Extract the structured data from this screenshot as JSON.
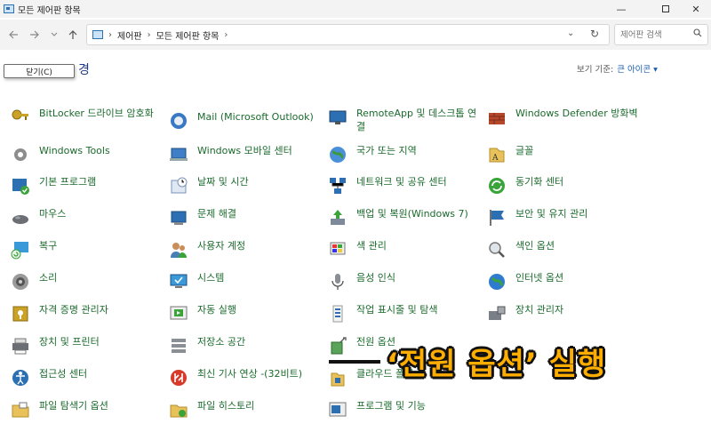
{
  "window": {
    "title": "모든 제어판 항목",
    "minimize": "—",
    "close": "✕"
  },
  "address": {
    "crumbs": [
      "제어판",
      "모든 제어판 항목"
    ],
    "search_placeholder": "제어판 검색"
  },
  "heading": "경",
  "view": {
    "label": "보기 기준:",
    "value": "큰 아이콘 ▾"
  },
  "tooltip": {
    "close_label": "닫기(C)"
  },
  "items": [
    {
      "label": "BitLocker 드라이브 암호화",
      "icon": "bitlocker-icon"
    },
    {
      "label": "Mail (Microsoft Outlook)",
      "icon": "mail-icon"
    },
    {
      "label": "RemoteApp 및 데스크톱 연결",
      "icon": "remoteapp-icon"
    },
    {
      "label": "Windows Defender 방화벽",
      "icon": "firewall-icon"
    },
    {
      "label": "Windows Tools",
      "icon": "windows-tools-icon"
    },
    {
      "label": "Windows 모바일 센터",
      "icon": "mobility-center-icon"
    },
    {
      "label": "국가 또는 지역",
      "icon": "region-icon"
    },
    {
      "label": "글꼴",
      "icon": "fonts-icon"
    },
    {
      "label": "기본 프로그램",
      "icon": "default-programs-icon"
    },
    {
      "label": "날짜 및 시간",
      "icon": "date-time-icon"
    },
    {
      "label": "네트워크 및 공유 센터",
      "icon": "network-icon"
    },
    {
      "label": "동기화 센터",
      "icon": "sync-center-icon"
    },
    {
      "label": "마우스",
      "icon": "mouse-icon"
    },
    {
      "label": "문제 해결",
      "icon": "troubleshoot-icon"
    },
    {
      "label": "백업 및 복원(Windows 7)",
      "icon": "backup-icon"
    },
    {
      "label": "보안 및 유지 관리",
      "icon": "security-flag-icon"
    },
    {
      "label": "복구",
      "icon": "recovery-icon"
    },
    {
      "label": "사용자 계정",
      "icon": "user-accounts-icon"
    },
    {
      "label": "색 관리",
      "icon": "color-management-icon"
    },
    {
      "label": "색인 옵션",
      "icon": "indexing-icon"
    },
    {
      "label": "소리",
      "icon": "sound-icon"
    },
    {
      "label": "시스템",
      "icon": "system-icon"
    },
    {
      "label": "음성 인식",
      "icon": "speech-icon"
    },
    {
      "label": "인터넷 옵션",
      "icon": "internet-options-icon"
    },
    {
      "label": "자격 증명 관리자",
      "icon": "credential-icon"
    },
    {
      "label": "자동 실행",
      "icon": "autoplay-icon"
    },
    {
      "label": "작업 표시줄 및 탐색",
      "icon": "taskbar-icon"
    },
    {
      "label": "장치 관리자",
      "icon": "device-manager-icon"
    },
    {
      "label": "장치 및 프린터",
      "icon": "printer-icon"
    },
    {
      "label": "저장소 공간",
      "icon": "storage-icon"
    },
    {
      "label": "전원 옵션",
      "icon": "power-icon"
    },
    {
      "label": "",
      "icon": "hidden-icon"
    },
    {
      "label": "접근성 센터",
      "icon": "accessibility-icon"
    },
    {
      "label": "최신 기사 연상 -(32비트)",
      "icon": "news-icon"
    },
    {
      "label": "클라우드 폴더",
      "icon": "cloud-folder-icon"
    },
    {
      "label": "",
      "icon": "hidden-icon"
    },
    {
      "label": "파일 탐색기 옵션",
      "icon": "folder-options-icon"
    },
    {
      "label": "파일 히스토리",
      "icon": "file-history-icon"
    },
    {
      "label": "프로그램 및 기능",
      "icon": "programs-icon"
    }
  ],
  "annotation": "‘전원 옵션’ 실행",
  "colors": {
    "link_green": "#1a6a2c",
    "accent": "#ffae00"
  }
}
